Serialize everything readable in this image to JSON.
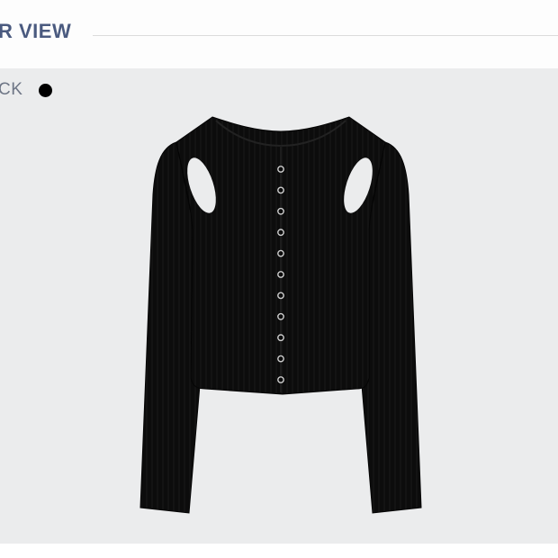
{
  "header": {
    "title": "R VIEW"
  },
  "color_selector": {
    "label": "CK",
    "selected_color": "#000000"
  },
  "product": {
    "icon": "cardigan-image",
    "color": "#0b0b0b",
    "snap_count": 11
  }
}
